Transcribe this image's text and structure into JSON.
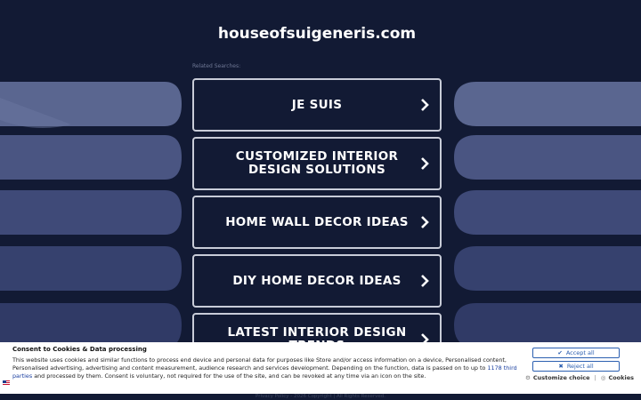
{
  "site": {
    "domain": "houseofsuigeneris.com"
  },
  "related_label": "Related Searches:",
  "tiles": [
    {
      "label": "JE SUIS"
    },
    {
      "label": "CUSTOMIZED INTERIOR DESIGN SOLUTIONS"
    },
    {
      "label": "HOME WALL DECOR IDEAS"
    },
    {
      "label": "DIY HOME DECOR IDEAS"
    },
    {
      "label": "LATEST INTERIOR DESIGN TRENDS"
    }
  ],
  "cookie": {
    "title": "Consent to Cookies & Data processing",
    "text_before": "This website uses cookies and similar functions to process end device and personal data for purposes like Store and/or access information on a device, Personalised content, Personalised advertising, advertising and content measurement, audience research and services development. Depending on the function, data is passed on to up to ",
    "link": "1178 third parties",
    "text_after": " and processed by them. Consent is voluntary, not required for the use of the site, and can be revoked at any time via an icon on the site.",
    "accept_label": "Accept all",
    "reject_label": "Reject all",
    "customize_label": "Customize choice",
    "separator": "|",
    "cookies_label": "Cookies"
  },
  "footer": {
    "privacy_label": "Privacy Policy",
    "copyright": "2026 Copyright | All Rights Reserved."
  },
  "colors": {
    "background": "#121a34",
    "accent": "#2b5fb0"
  }
}
